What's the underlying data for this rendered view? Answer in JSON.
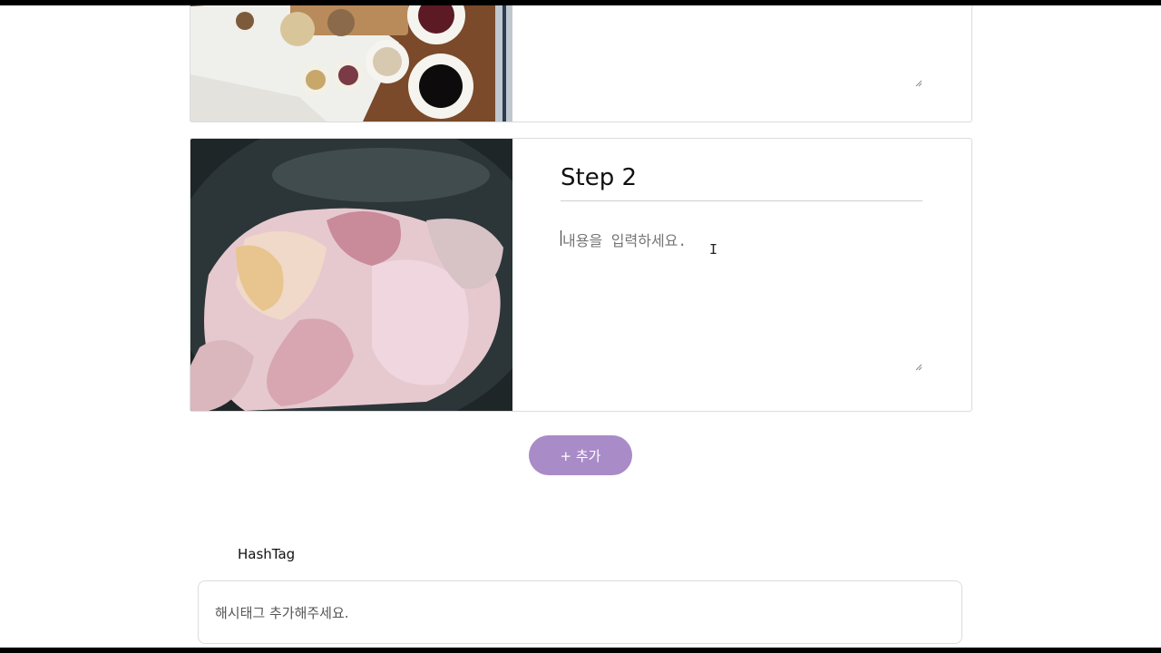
{
  "steps": [
    {
      "photo": "spices-and-sauces-photo",
      "title": "",
      "content_placeholder": ""
    },
    {
      "photo": "raw-chicken-in-pan-photo",
      "title": "Step 2",
      "content_placeholder": "내용을 입력하세요."
    }
  ],
  "add_button": {
    "label": "+ 추가"
  },
  "hashtag": {
    "label": "HashTag",
    "placeholder": "해시태그 추가해주세요."
  },
  "colors": {
    "accent": "#a98bc7",
    "border": "#dcdcdc"
  }
}
